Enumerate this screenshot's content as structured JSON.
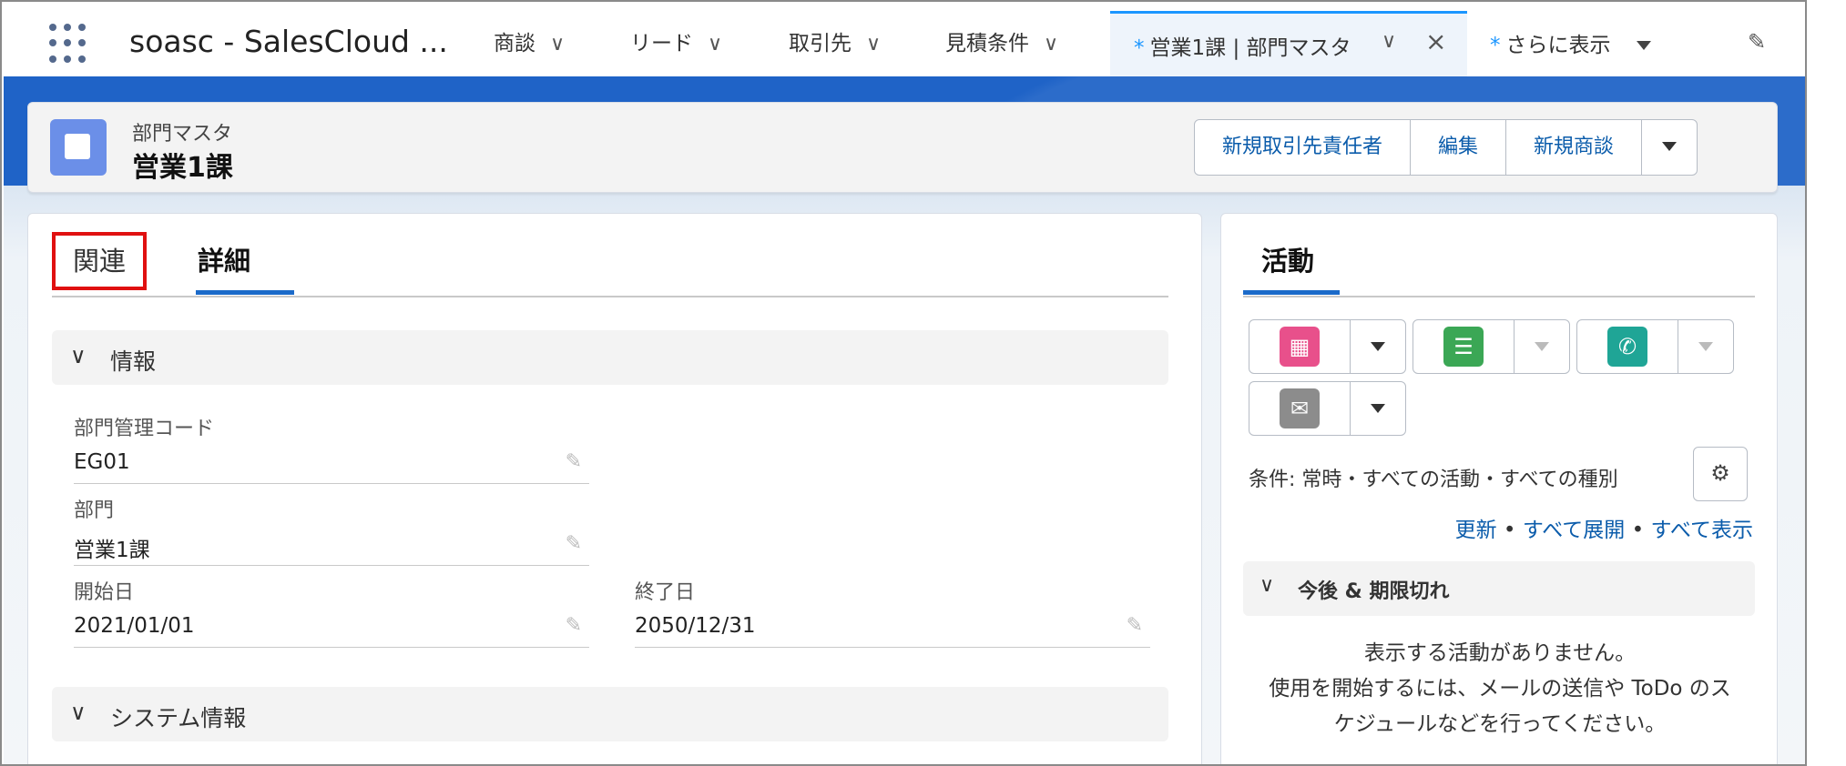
{
  "nav": {
    "app_name": "soasc - SalesCloud ...",
    "items": [
      {
        "label": "商談"
      },
      {
        "label": "リード"
      },
      {
        "label": "取引先"
      },
      {
        "label": "見積条件"
      }
    ],
    "active_tab": {
      "marker": "*",
      "label": "営業1課 | 部門マスタ"
    },
    "more_tab": {
      "marker": "*",
      "label": "さらに表示"
    }
  },
  "header": {
    "object_label": "部門マスタ",
    "record_name": "営業1課",
    "buttons": [
      "新規取引先責任者",
      "編集",
      "新規商談"
    ]
  },
  "main": {
    "tabs": {
      "related": "関連",
      "details": "詳細"
    },
    "sections": {
      "info": "情報",
      "system": "システム情報"
    },
    "fields": {
      "code_label": "部門管理コード",
      "code_value": "EG01",
      "dept_label": "部門",
      "dept_value": "営業1課",
      "start_label": "開始日",
      "start_value": "2021/01/01",
      "end_label": "終了日",
      "end_value": "2050/12/31"
    }
  },
  "activity": {
    "tab_label": "活動",
    "colors": {
      "event": "#e8508b",
      "task": "#3ba755",
      "call": "#1fa596",
      "email": "#8c8c8c"
    },
    "filter_text": "条件: 常時・すべての活動・すべての種別",
    "links": {
      "refresh": "更新",
      "sep1": " • ",
      "expand": "すべて展開",
      "sep2": " • ",
      "show_all": "すべて表示"
    },
    "upcoming_title": "今後 & 期限切れ",
    "empty_line1": "表示する活動がありません。",
    "empty_line2": "使用を開始するには、メールの送信や ToDo のス",
    "empty_line3": "ケジュールなどを行ってください。"
  }
}
